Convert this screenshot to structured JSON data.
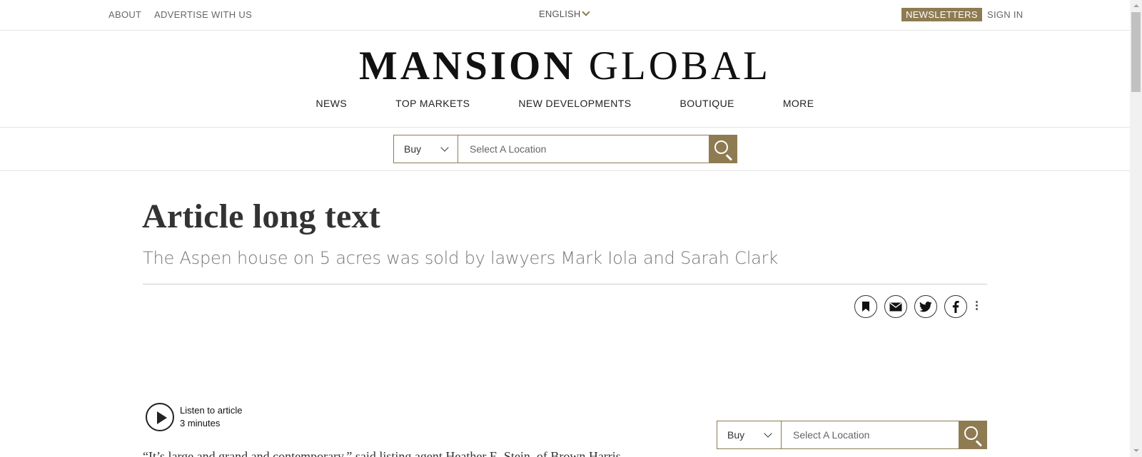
{
  "utility": {
    "about": "ABOUT",
    "advertise": "ADVERTISE WITH US",
    "language": "ENGLISH",
    "newsletters": "NEWSLETTERS",
    "signin": "SIGN IN"
  },
  "logo": {
    "bold": "MANSION",
    "light": "GLOBAL"
  },
  "nav": [
    "NEWS",
    "TOP MARKETS",
    "NEW DEVELOPMENTS",
    "BOUTIQUE",
    "MORE"
  ],
  "search_top": {
    "type": "Buy",
    "placeholder": "Select A Location"
  },
  "article": {
    "headline": "Article long text",
    "dek": "The Aspen house on 5 acres was sold by lawyers Mark Iola and Sarah Clark",
    "listen_label": "Listen to article",
    "listen_duration": "3 minutes",
    "body_first_line": "“It’s large and grand and contemporary,” said listing agent Heather E. Stein, of Brown Harris"
  },
  "search_side": {
    "type": "Buy",
    "placeholder": "Select A Location"
  },
  "colors": {
    "accent": "#8e7b52"
  },
  "icons": [
    "bookmark-icon",
    "email-icon",
    "twitter-icon",
    "facebook-icon",
    "more-options-icon",
    "search-icon",
    "play-icon",
    "chevron-down-icon"
  ]
}
